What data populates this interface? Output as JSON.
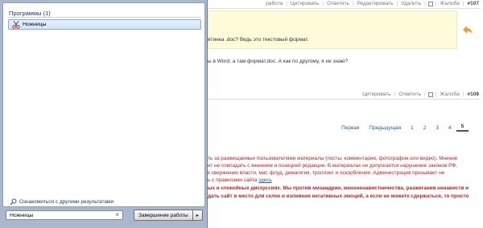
{
  "start_menu": {
    "programs_header": "Программы (1)",
    "result_item": "Ножницы",
    "see_more": "Ознакомиться с другими результатами",
    "search_value": "Ножницы",
    "clear_glyph": "×",
    "shutdown_label": "Завершение работы",
    "shutdown_arrow": "▸"
  },
  "forum": {
    "top_actions": [
      "работа",
      "Цитировать",
      "Ответить",
      "Редактировать",
      "Удалить",
      "Жалоба"
    ],
    "top_post_number": "#107",
    "yellow_text": "ятинка .doc? Ведь это текстовый формат.",
    "post_text": "ы в Word, а там формат.doc. А как по другому, я не знаю?",
    "bottom_actions": [
      "Цитировать",
      "Ответить",
      "Жалоба"
    ],
    "bottom_post_number": "#108",
    "pagination": {
      "first": "Первая",
      "prev": "Предыдущая",
      "pages": [
        "1",
        "2",
        "3",
        "4"
      ],
      "current": "5"
    },
    "disclaimer": {
      "line1": "ть за размещаемые пользователями материалы (посты, комментарии, фотографии или видео). Мнение",
      "line2": "ет не совпадать с мнением и позицией редакции. В материалах не допускается нарушение законов РФ,",
      "line3": "к свержению власти, мат, флуд, демагогия, троллинг и оскорбления. Администрация призывает не",
      "line4_prefix": "ь с правилами сайта",
      "line4_link": "здесь",
      "line5": "ых и спокойных дискуссиях. Мы против мизандрии, женоненавистничества, разжигания ненависти и",
      "line6": "дать сайт в место для склок и излияния негативных эмоций, а если не можете сдержаться, то просто"
    }
  }
}
